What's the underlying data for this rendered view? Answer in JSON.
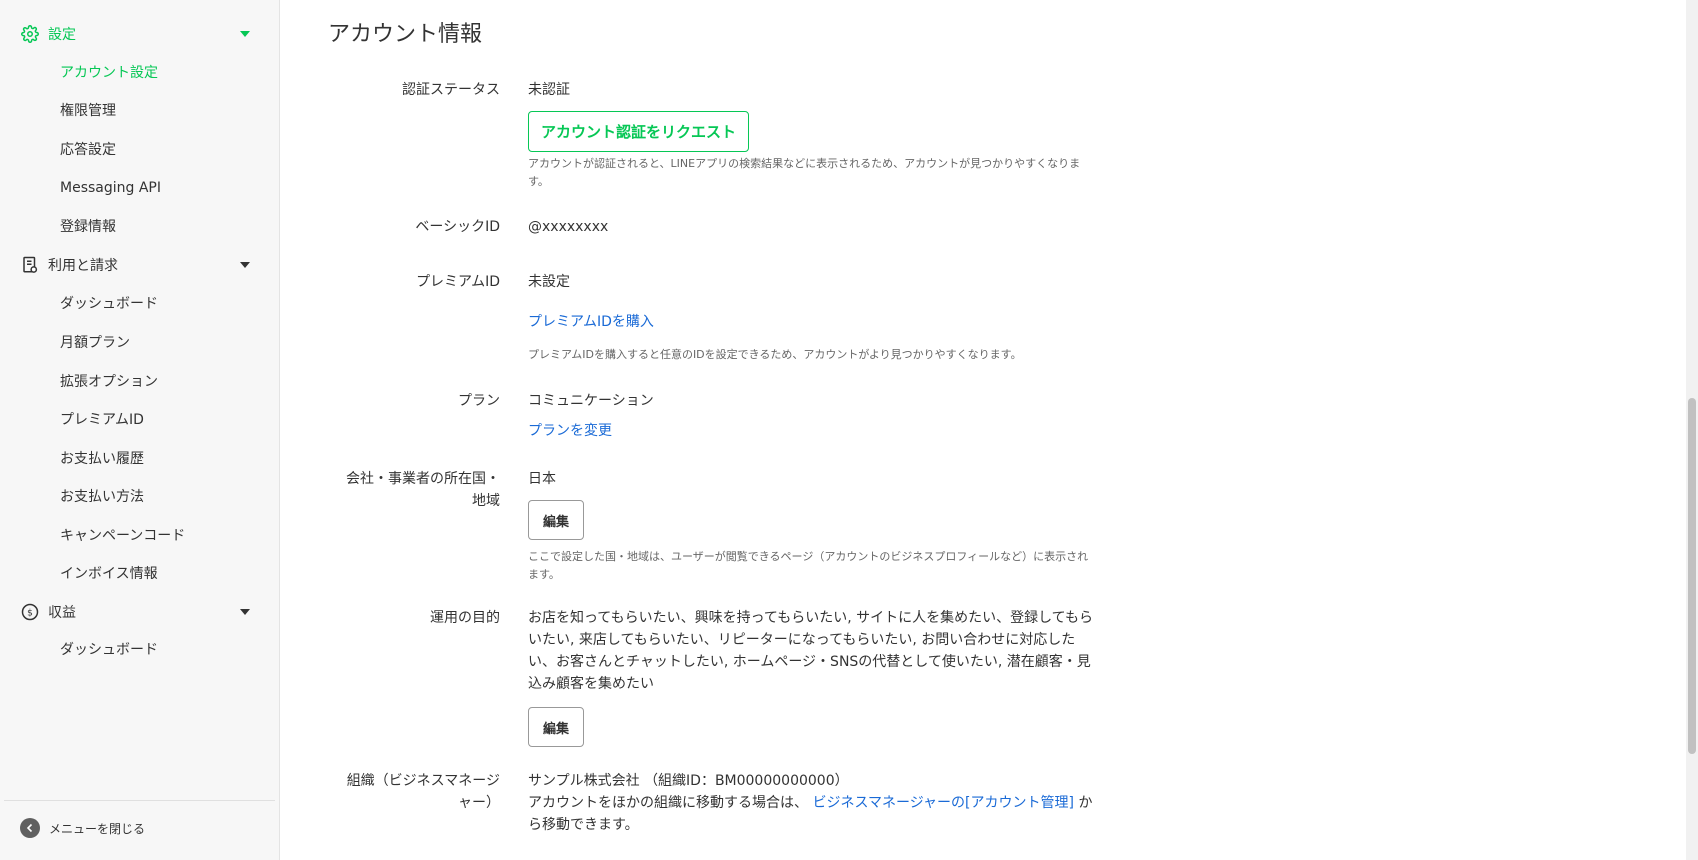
{
  "sidebar": {
    "sections": [
      {
        "label": "設定",
        "items": [
          "アカウント設定",
          "権限管理",
          "応答設定",
          "Messaging API",
          "登録情報"
        ]
      },
      {
        "label": "利用と請求",
        "items": [
          "ダッシュボード",
          "月額プラン",
          "拡張オプション",
          "プレミアムID",
          "お支払い履歴",
          "お支払い方法",
          "キャンペーンコード",
          "インボイス情報"
        ]
      },
      {
        "label": "収益",
        "items": [
          "ダッシュボード"
        ]
      }
    ],
    "close_menu": "メニューを閉じる"
  },
  "main": {
    "title": "アカウント情報",
    "verification": {
      "label": "認証ステータス",
      "value": "未認証",
      "button": "アカウント認証をリクエスト",
      "help": "アカウントが認証されると、LINEアプリの検索結果などに表示されるため、アカウントが見つかりやすくなります。"
    },
    "basic_id": {
      "label": "ベーシックID",
      "value": "@xxxxxxxx"
    },
    "premium_id": {
      "label": "プレミアムID",
      "value": "未設定",
      "link": "プレミアムIDを購入",
      "help": "プレミアムIDを購入すると任意のIDを設定できるため、アカウントがより見つかりやすくなります。"
    },
    "plan": {
      "label": "プラン",
      "value": "コミュニケーション",
      "link": "プランを変更"
    },
    "country": {
      "label_line1": "会社・事業者の所在国・",
      "label_line2": "地域",
      "value": "日本",
      "button": "編集",
      "help": "ここで設定した国・地域は、ユーザーが閲覧できるページ（アカウントのビジネスプロフィールなど）に表示されます。"
    },
    "purpose": {
      "label": "運用の目的",
      "value": "お店を知ってもらいたい、興味を持ってもらいたい, サイトに人を集めたい、登録してもらいたい, 来店してもらいたい、リピーターになってもらいたい, お問い合わせに対応したい、お客さんとチャットしたい, ホームページ・SNSの代替として使いたい, 潜在顧客・見込み顧客を集めたい",
      "button": "編集"
    },
    "organization": {
      "label_line1": "組織（ビジネスマネージ",
      "label_line2": "ャー）",
      "value": "サンプル株式会社 （組織ID：BM00000000000）",
      "text_before": "アカウントをほかの組織に移動する場合は、",
      "link": "ビジネスマネージャーの[アカウント管理]",
      "text_after": "から移動できます。"
    }
  },
  "colors": {
    "accent": "#06c755",
    "link": "#1a6ad6"
  }
}
